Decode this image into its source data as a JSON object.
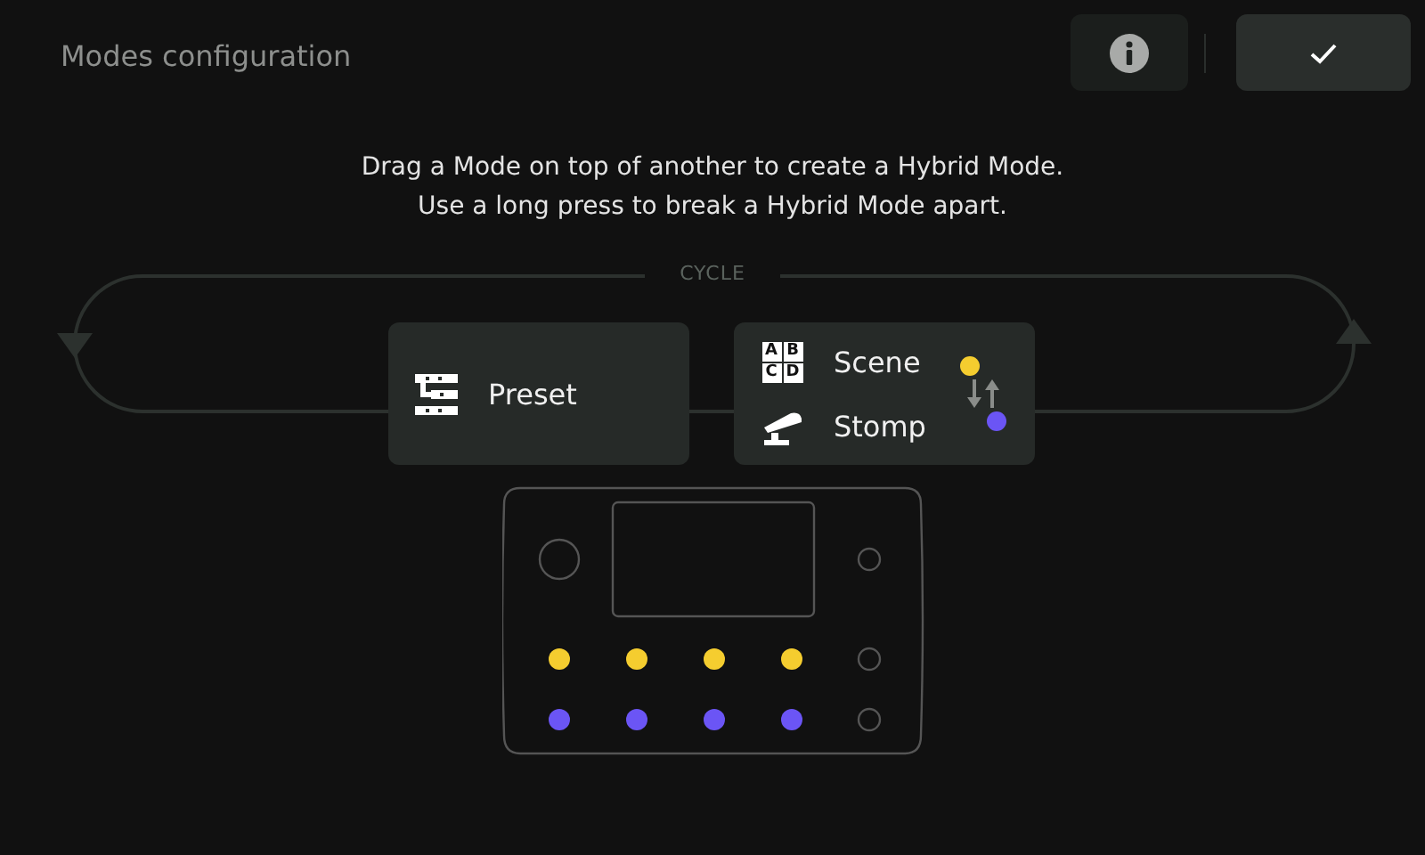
{
  "header": {
    "title": "Modes configuration",
    "buttons": [
      {
        "kind": "info"
      },
      {
        "kind": "confirm"
      }
    ]
  },
  "instructions": "Drag a Mode on top of another to create a Hybrid Mode. Use a long press to break a Hybrid Mode apart.",
  "cycle": {
    "label": "CYCLE"
  },
  "modes": [
    {
      "items": [
        {
          "kind": "preset",
          "label": "Preset"
        }
      ]
    },
    {
      "items": [
        {
          "kind": "scene",
          "label": "Scene",
          "letters": [
            "A",
            "B",
            "C",
            "D"
          ],
          "color": "#f5cd2f"
        },
        {
          "kind": "stomp",
          "label": "Stomp",
          "color": "#6b55f5"
        }
      ]
    }
  ],
  "device": {
    "led_rows": [
      {
        "leds": [
          {
            "color": "#f5cd2f"
          },
          {
            "color": "#f5cd2f"
          },
          {
            "color": "#f5cd2f"
          },
          {
            "color": "#f5cd2f"
          }
        ]
      },
      {
        "leds": [
          {
            "color": "#6b55f5"
          },
          {
            "color": "#6b55f5"
          },
          {
            "color": "#6b55f5"
          },
          {
            "color": "#6b55f5"
          }
        ]
      }
    ]
  }
}
